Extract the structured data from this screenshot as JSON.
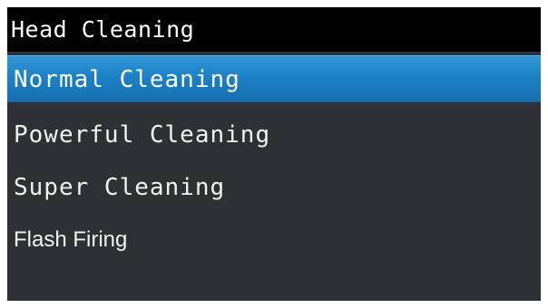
{
  "screen": {
    "title": "Head Cleaning"
  },
  "menu": {
    "items": [
      {
        "label": "Normal Cleaning",
        "selected": true
      },
      {
        "label": "Powerful Cleaning",
        "selected": false
      },
      {
        "label": "Super Cleaning",
        "selected": false
      },
      {
        "label": "Flash Firing",
        "selected": false
      }
    ]
  },
  "colors": {
    "background": "#2e3035",
    "title_bar": "#000000",
    "selection": "#1c7fc4",
    "text": "#ffffff"
  }
}
